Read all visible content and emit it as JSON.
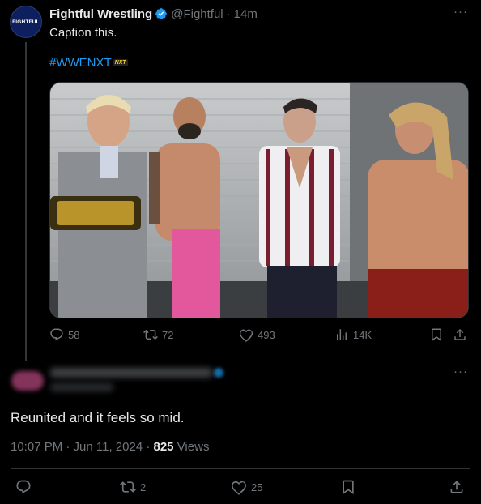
{
  "tweet": {
    "avatar_text": "FIGHTFUL",
    "author_name": "Fightful Wrestling",
    "handle": "@Fightful",
    "separator": "·",
    "time": "14m",
    "more": "···",
    "text": "Caption this.",
    "hashtag": "#WWENXT",
    "hashtag_badge": "NXT",
    "counts": {
      "replies": "58",
      "reposts": "72",
      "likes": "493",
      "views": "14K"
    }
  },
  "reply": {
    "more": "···",
    "text": "Reunited and it feels so mid.",
    "time_date": "10:07 PM · Jun 11, 2024 · ",
    "views_count": "825",
    "views_label": " Views",
    "counts": {
      "reposts": "2",
      "likes": "25"
    }
  },
  "colors": {
    "background": "#000000",
    "text": "#e7e9ea",
    "muted": "#71767b",
    "link": "#1d9bf0",
    "border": "#2f3336"
  },
  "icons": [
    "verified-badge-icon",
    "reply-icon",
    "repost-icon",
    "like-icon",
    "views-icon",
    "bookmark-icon",
    "share-icon"
  ]
}
